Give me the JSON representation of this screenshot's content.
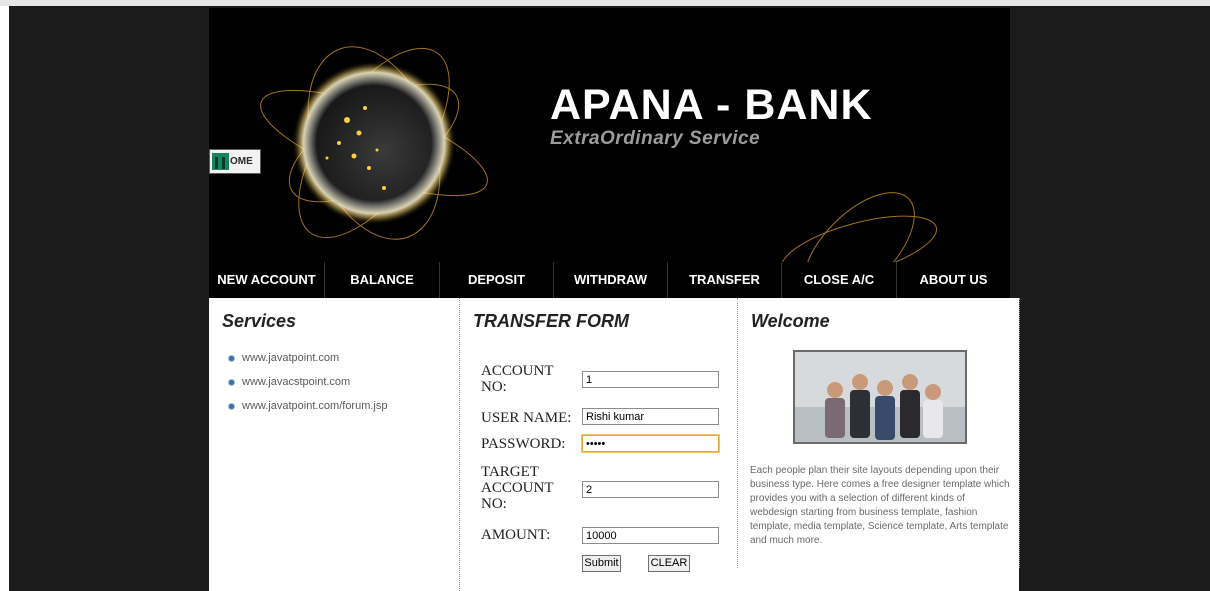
{
  "header": {
    "title": "APANA - BANK",
    "tagline": "ExtraOrdinary Service",
    "home_label": "OME"
  },
  "nav": [
    {
      "label": "NEW ACCOUNT"
    },
    {
      "label": "BALANCE"
    },
    {
      "label": "DEPOSIT"
    },
    {
      "label": "WITHDRAW"
    },
    {
      "label": "TRANSFER"
    },
    {
      "label": "CLOSE A/C"
    },
    {
      "label": "ABOUT US"
    }
  ],
  "services": {
    "heading": "Services",
    "links": [
      "www.javatpoint.com",
      "www.javacstpoint.com",
      "www.javatpoint.com/forum.jsp"
    ]
  },
  "form": {
    "heading": "TRANSFER FORM",
    "account_label_1": "ACCOUNT",
    "account_label_2": "NO:",
    "account_value": "1",
    "username_label": "USER NAME:",
    "username_value": "Rishi kumar",
    "password_label": "PASSWORD:",
    "password_value": "•••••",
    "target_label_1": "TARGET",
    "target_label_2": "ACCOUNT",
    "target_label_3": "NO:",
    "target_value": "2",
    "amount_label": "AMOUNT:",
    "amount_value": "10000",
    "submit_label": "Submit",
    "clear_label": "CLEAR"
  },
  "welcome": {
    "heading": "Welcome",
    "text": "Each people plan their site layouts depending upon their business type. Here comes a free designer template which provides you with a selection of different kinds of webdesign starting from business template, fashion template, media template, Science template, Arts template and much more."
  },
  "colors": {
    "page_bg": "#1b1b1b",
    "header_bg": "#000000",
    "nav_text": "#ffffff",
    "focus_border": "#e3a92e"
  }
}
